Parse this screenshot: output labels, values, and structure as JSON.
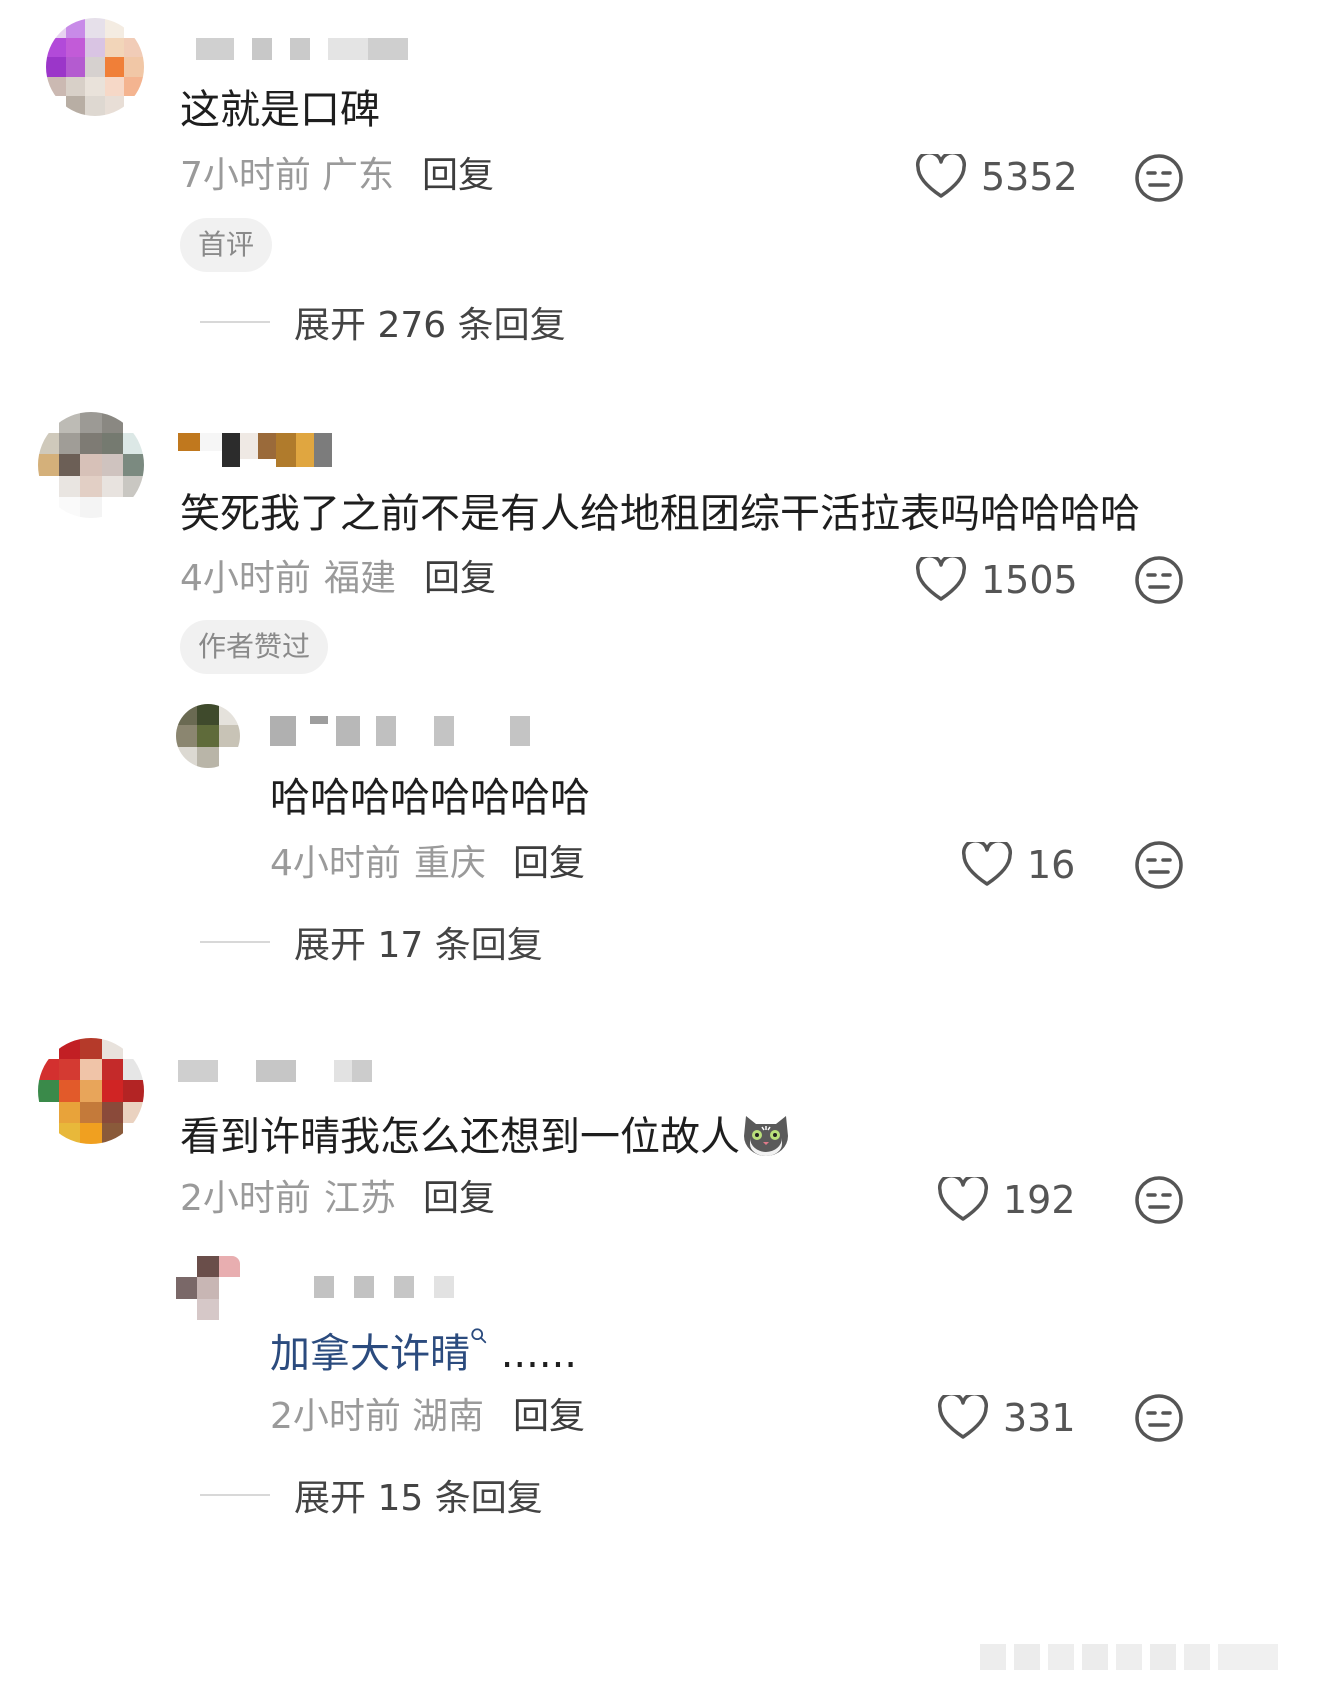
{
  "comments": [
    {
      "text": "这就是口碑",
      "time": "7小时前",
      "location": "广东",
      "reply_label": "回复",
      "likes": "5352",
      "badge": "首评",
      "expand": "展开 276 条回复"
    },
    {
      "text": "笑死我了之前不是有人给地租团综干活拉表吗哈哈哈哈",
      "time": "4小时前",
      "location": "福建",
      "reply_label": "回复",
      "likes": "1505",
      "badge": "作者赞过",
      "sub": {
        "text": "哈哈哈哈哈哈哈哈",
        "time": "4小时前",
        "location": "重庆",
        "reply_label": "回复",
        "likes": "16"
      },
      "expand": "展开 17 条回复"
    },
    {
      "text": "看到许晴我怎么还想到一位故人",
      "time": "2小时前",
      "location": "江苏",
      "reply_label": "回复",
      "likes": "192",
      "sub": {
        "link_text": "加拿大许晴",
        "text_suffix": " ......",
        "time": "2小时前",
        "location": "湖南",
        "reply_label": "回复",
        "likes": "331"
      },
      "expand": "展开 15 条回复"
    }
  ],
  "icons": {
    "like": "heart-outline-icon",
    "dislike": "meh-face-icon",
    "search": "search-icon",
    "emoji": "cat-face-emoji"
  },
  "colors": {
    "background": "#ffffff",
    "text": "#1e1e1e",
    "meta": "#9a9a9a",
    "link": "#2b4b7e"
  }
}
